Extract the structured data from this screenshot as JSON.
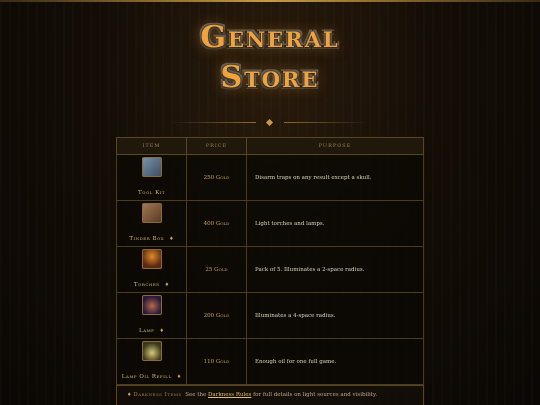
{
  "title": {
    "line1": "General",
    "line2": "Store"
  },
  "table": {
    "headers": [
      "Item",
      "Price",
      "Purpose"
    ],
    "rows": [
      {
        "icon": "tool-kit-icon",
        "name": "Tool Kit",
        "marker": "",
        "price": "250 Gold",
        "purpose": "Disarm traps on any result except a skull."
      },
      {
        "icon": "tinder-box-icon",
        "name": "Tinder Box",
        "marker": "♦",
        "price": "400 Gold",
        "purpose": "Light torches and lamps."
      },
      {
        "icon": "torches-icon",
        "name": "Torches",
        "marker": "♦",
        "price": "25 Gold",
        "purpose": "Pack of 5. Illuminates a 2-space radius."
      },
      {
        "icon": "lamp-icon",
        "name": "Lamp",
        "marker": "♦",
        "price": "200 Gold",
        "purpose": "Illuminates a 4-space radius."
      },
      {
        "icon": "lamp-oil-refill-icon",
        "name": "Lamp Oil Refill",
        "marker": "♦",
        "price": "110 Gold",
        "purpose": "Enough oil for one full game."
      }
    ]
  },
  "note": {
    "marker": "♦",
    "label": "Darkness Items",
    "text_before": "See the",
    "link": "Darkness Rules",
    "text_after": "for full details on light sources and visibility."
  }
}
